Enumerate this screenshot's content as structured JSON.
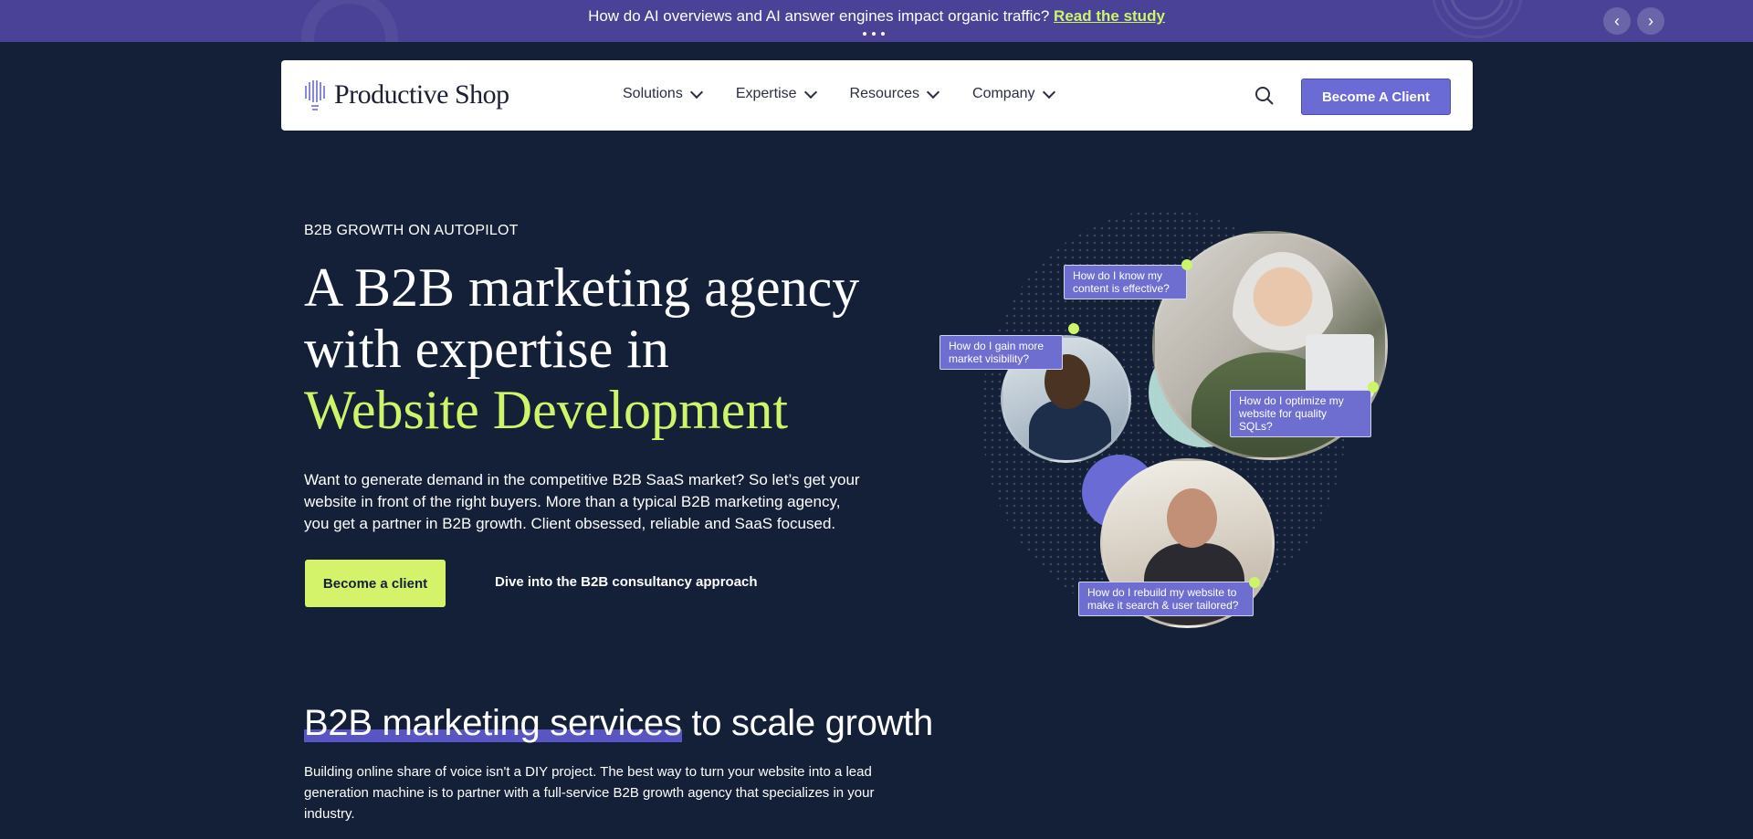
{
  "announcement": {
    "text": "How do AI overviews and AI answer engines impact organic traffic?",
    "link": "Read the study",
    "prev_icon": "chevron-left-icon",
    "next_icon": "chevron-right-icon"
  },
  "nav": {
    "logo": "Productive Shop",
    "menu": [
      "Solutions",
      "Expertise",
      "Resources",
      "Company"
    ],
    "search_icon": "search-icon",
    "cta": "Become A Client"
  },
  "hero": {
    "eyebrow": "B2B GROWTH ON AUTOPILOT",
    "headline_1": "A B2B marketing agency",
    "headline_2": "with expertise in",
    "headline_highlight": "Website Development",
    "lead": "Want to generate demand in the competitive B2B SaaS market? So let’s get your website in front of the right buyers. More than a typical B2B marketing agency, you get a partner in B2B growth. Client obsessed, reliable and SaaS focused.",
    "primary_cta": "Become a client",
    "secondary_cta": "Dive into the B2B consultancy approach"
  },
  "illustration": {
    "bubbles": [
      "How do I know my content is effective?",
      "How do I gain more market visibility?",
      "How do I optimize my website for quality SQLs?",
      "How do I rebuild my website to make it search & user tailored?"
    ]
  },
  "services": {
    "title_highlight": "B2B marketing services",
    "title_rest": " to scale growth",
    "body": "Building online share of voice isn't a DIY project. The best way to turn your website into a lead generation machine is to partner with a full-service B2B growth agency that specializes in your industry."
  },
  "colors": {
    "background": "#142037",
    "accent_green": "#cdf56a",
    "accent_purple": "#6b6bd6",
    "announcement_bg": "#4a4296"
  }
}
